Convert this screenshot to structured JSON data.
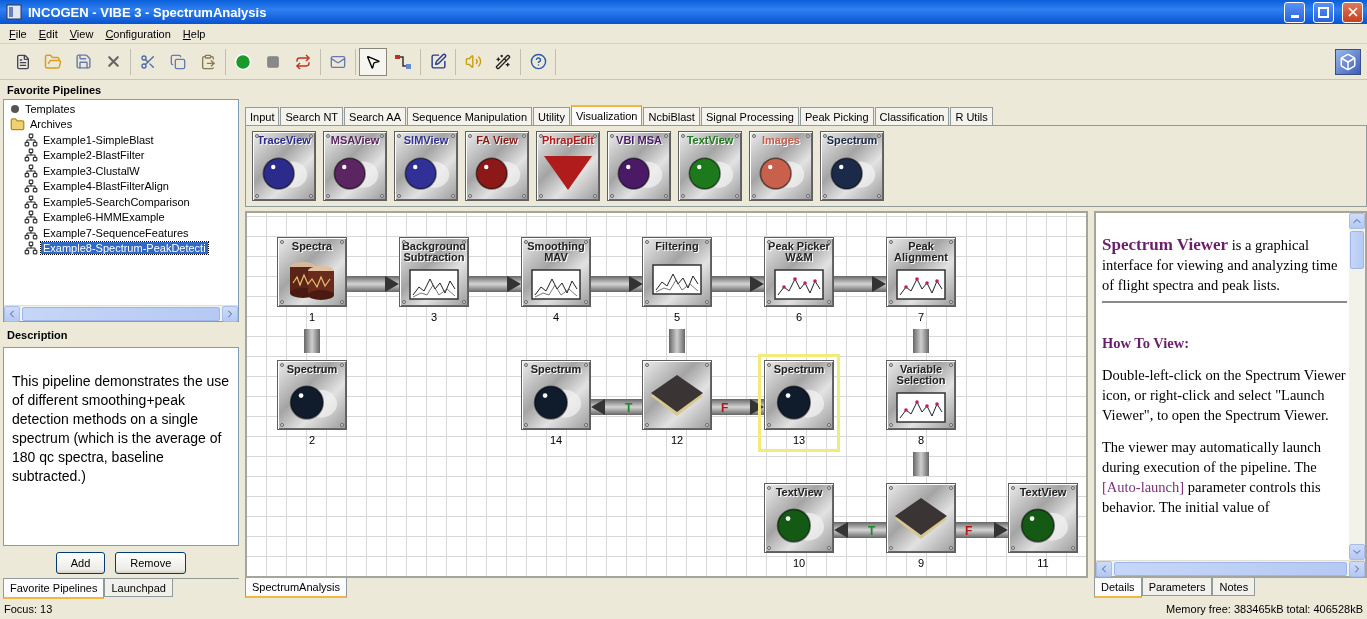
{
  "window": {
    "title": "INCOGEN - VIBE 3  - SpectrumAnalysis"
  },
  "menu": [
    "File",
    "Edit",
    "View",
    "Configuration",
    "Help"
  ],
  "toolbar": [
    [
      {
        "selected": false
      },
      {
        "selected": false
      },
      {
        "selected": false
      },
      {
        "selected": false
      }
    ],
    [
      {
        "selected": false
      },
      {
        "selected": false
      },
      {
        "selected": false
      }
    ],
    [
      {
        "selected": false
      },
      {
        "selected": false
      },
      {
        "selected": false
      }
    ],
    [
      {
        "selected": false
      }
    ],
    [
      {
        "selected": true
      },
      {
        "selected": false
      }
    ],
    [
      {
        "selected": false
      }
    ],
    [
      {
        "selected": false
      },
      {
        "selected": false
      }
    ],
    [
      {
        "selected": false
      }
    ]
  ],
  "favorites": {
    "title": "Favorite Pipelines",
    "tree": [
      {
        "label": "Templates",
        "kind": "template",
        "selected": false
      },
      {
        "label": "Archives",
        "kind": "folder",
        "selected": false,
        "children": [
          {
            "label": "Example1-SimpleBlast",
            "kind": "pipeline",
            "selected": false
          },
          {
            "label": "Example2-BlastFilter",
            "kind": "pipeline",
            "selected": false
          },
          {
            "label": "Example3-ClustalW",
            "kind": "pipeline",
            "selected": false
          },
          {
            "label": "Example4-BlastFilterAlign",
            "kind": "pipeline",
            "selected": false
          },
          {
            "label": "Example5-SearchComparison",
            "kind": "pipeline",
            "selected": false
          },
          {
            "label": "Example6-HMMExample",
            "kind": "pipeline",
            "selected": false
          },
          {
            "label": "Example7-SequenceFeatures",
            "kind": "pipeline",
            "selected": false
          },
          {
            "label": "Example8-Spectrum-PeakDetecti",
            "kind": "pipeline",
            "selected": true
          }
        ]
      }
    ]
  },
  "description": {
    "title": "Description",
    "text": "This pipeline demonstrates the use of different smoothing+peak detection methods on a single spectrum (which is the average of 180 qc spectra, baseline subtracted.)"
  },
  "description_buttons": [
    "Add",
    "Remove"
  ],
  "left_tabs": [
    {
      "label": "Favorite Pipelines",
      "selected": true
    },
    {
      "label": "Launchpad",
      "selected": false
    }
  ],
  "palette_tabs": [
    {
      "label": "Input",
      "selected": false
    },
    {
      "label": "Search NT",
      "selected": false
    },
    {
      "label": "Search AA",
      "selected": false
    },
    {
      "label": "Sequence Manipulation",
      "selected": false
    },
    {
      "label": "Utility",
      "selected": false
    },
    {
      "label": "Visualization",
      "selected": true
    },
    {
      "label": "NcbiBlast",
      "selected": false
    },
    {
      "label": "Signal Processing",
      "selected": false
    },
    {
      "label": "Peak Picking",
      "selected": false
    },
    {
      "label": "Classification",
      "selected": false
    },
    {
      "label": "R Utils",
      "selected": false
    }
  ],
  "palette": [
    {
      "label": "TraceView",
      "kind": "sphere",
      "color": "#2b2b8c"
    },
    {
      "label": "MSAView",
      "kind": "sphere",
      "color": "#5a2560"
    },
    {
      "label": "SIMView",
      "kind": "sphere",
      "color": "#303096"
    },
    {
      "label": "FA View",
      "kind": "sphere",
      "color": "#8c1818"
    },
    {
      "label": "PhrapEdit",
      "kind": "triangle",
      "color": "#b01c1c"
    },
    {
      "label": "VBI MSA",
      "kind": "sphere",
      "color": "#4a1a66"
    },
    {
      "label": "TextView",
      "kind": "sphere",
      "color": "#1c7a1c"
    },
    {
      "label": "Images",
      "kind": "sphere",
      "color": "#c8604c"
    },
    {
      "label": "Spectrum",
      "kind": "sphere",
      "color": "#1a2a48"
    }
  ],
  "nodes": [
    {
      "label": "Spectra",
      "number": "1",
      "kind": "drum",
      "selected": false
    },
    {
      "label": "Background Subtraction",
      "number": "3",
      "kind": "chart",
      "selected": false
    },
    {
      "label": "Smoothing MAV",
      "number": "4",
      "kind": "chart",
      "selected": false
    },
    {
      "label": "Filtering",
      "number": "5",
      "kind": "chart",
      "selected": false
    },
    {
      "label": "Peak Picker W&M",
      "number": "6",
      "kind": "peaks",
      "selected": false
    },
    {
      "label": "Peak Alignment",
      "number": "7",
      "kind": "peaks",
      "selected": false
    },
    {
      "label": "Spectrum",
      "number": "2",
      "kind": "sphere",
      "color": "#101c2c",
      "selected": false
    },
    {
      "label": "Spectrum",
      "number": "14",
      "kind": "sphere",
      "color": "#101c2c",
      "selected": false
    },
    {
      "number": "12",
      "kind": "plate",
      "selected": false
    },
    {
      "label": "Spectrum",
      "number": "13",
      "kind": "sphere",
      "color": "#101c2c",
      "selected": true
    },
    {
      "label": "Variable Selection",
      "number": "8",
      "kind": "peaks",
      "selected": false
    },
    {
      "label": "TextView",
      "number": "10",
      "kind": "sphere",
      "color": "#145a14",
      "selected": false
    },
    {
      "number": "9",
      "kind": "plate",
      "selected": false
    },
    {
      "label": "TextView",
      "number": "11",
      "kind": "sphere",
      "color": "#145a14",
      "selected": false
    }
  ],
  "connectors": [
    {
      "kind": "arrow"
    },
    {
      "kind": "arrow"
    },
    {
      "kind": "arrow"
    },
    {
      "kind": "arrow"
    },
    {
      "kind": "arrow"
    },
    {
      "kind": "pipe"
    },
    {
      "kind": "pipe"
    },
    {
      "kind": "pipe"
    },
    {
      "kind": "pipe"
    },
    {
      "kind": "branch",
      "label": "T",
      "color": "#1a8a2a"
    },
    {
      "kind": "branch",
      "label": "F",
      "color": "#b01818"
    },
    {
      "kind": "branch",
      "label": "T",
      "color": "#1a8a2a"
    },
    {
      "kind": "branch",
      "label": "F",
      "color": "#b01818"
    }
  ],
  "canvas_tabs": [
    {
      "label": "SpectrumAnalysis",
      "selected": true
    }
  ],
  "details": {
    "intro": "**Spectrum Viewer** is a graphical interface for viewing and analyzing time of flight spectra and peak lists.",
    "heading": "How To View:",
    "paragraph": "Double-left-click on the Spectrum Viewer icon, or right-click and select \"Launch Viewer\", to open the Spectrum Viewer.",
    "paragraph2_before": "The viewer may automatically launch during execution of the pipeline. The",
    "paragraph2_link": "[Auto-launch]",
    "paragraph2_after": "parameter controls this behavior. The initial value of"
  },
  "details_tabs": [
    {
      "label": "Details",
      "selected": true
    },
    {
      "label": "Parameters",
      "selected": false
    },
    {
      "label": "Notes",
      "selected": false
    }
  ],
  "status_bar": {
    "focus": "Focus: 13",
    "memory": "Memory free: 383465kB total: 406528kB"
  }
}
